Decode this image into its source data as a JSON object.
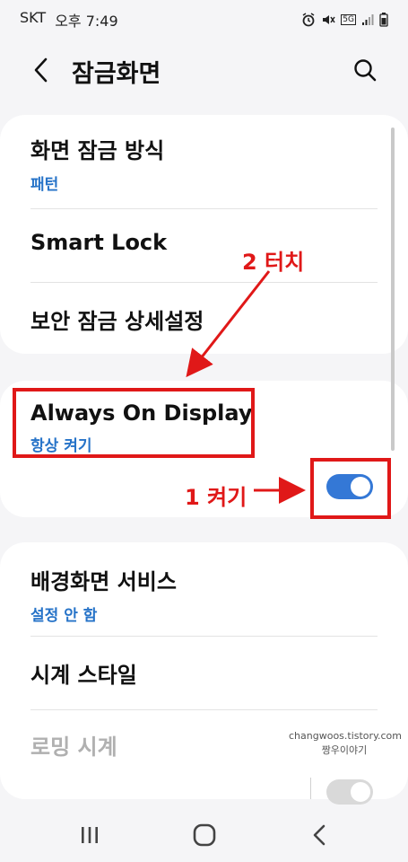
{
  "status": {
    "carrier": "SKT",
    "time": "오후 7:49",
    "signal_label": "5G"
  },
  "header": {
    "title": "잠금화면"
  },
  "group1": {
    "lock_type": {
      "title": "화면 잠금 방식",
      "value": "패턴"
    },
    "smart_lock": {
      "title": "Smart Lock"
    },
    "secure_lock": {
      "title": "보안 잠금 상세설정"
    }
  },
  "group2": {
    "aod": {
      "title": "Always On Display",
      "value": "항상 켜기",
      "enabled": true
    }
  },
  "group3": {
    "wallpaper_services": {
      "title": "배경화면 서비스",
      "value": "설정 안 함"
    },
    "clock_style": {
      "title": "시계 스타일"
    },
    "roaming_clock": {
      "title": "로밍 시계",
      "enabled": false
    }
  },
  "annotations": {
    "step1": "1 켜기",
    "step2": "2 터치",
    "color": "#e01818"
  },
  "watermark": {
    "line1": "changwoos.tistory.com",
    "line2": "짱우이야기"
  },
  "colors": {
    "accent": "#3478d6",
    "subtext": "#2673c8"
  }
}
